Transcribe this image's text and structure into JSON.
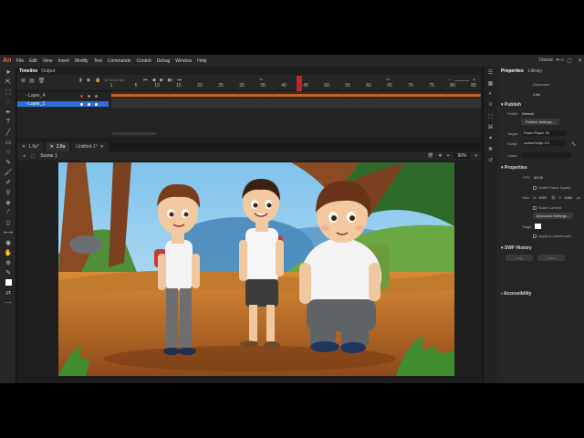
{
  "app": {
    "logo": "An",
    "menu": [
      "File",
      "Edit",
      "View",
      "Insert",
      "Modify",
      "Text",
      "Commands",
      "Control",
      "Debug",
      "Window",
      "Help"
    ],
    "workspace": "Classic"
  },
  "timeline": {
    "tabs": [
      "Timeline",
      "Output"
    ],
    "fps_readout": "10    30.00 fps",
    "ruler": [
      "1",
      "5",
      "10",
      "15",
      "20",
      "25",
      "30",
      "35",
      "40",
      "45",
      "50",
      "55",
      "60",
      "65",
      "70",
      "75",
      "80",
      "85"
    ],
    "seconds": [
      "1s",
      "2s"
    ],
    "layers": [
      {
        "name": "Layer_4",
        "selected": false
      },
      {
        "name": "Layer_1",
        "selected": true
      }
    ]
  },
  "documents": {
    "tabs": [
      "1.fla*",
      "2.fla",
      "Untitled-1*"
    ],
    "scene": "Scene 1",
    "zoom": "90%"
  },
  "properties": {
    "tabs": [
      "Properties",
      "Library"
    ],
    "doc_label": "Document",
    "file_name": "2.fla",
    "publish_heading": "Publish",
    "profile_label": "Profile:",
    "profile_value": "Default",
    "publish_settings_btn": "Publish Settings...",
    "target_label": "Target:",
    "target_value": "Flash Player 30",
    "script_label": "Script:",
    "script_value": "ActionScript 3.0",
    "class_label": "Class:",
    "properties_heading": "Properties",
    "fps_label": "FPS",
    "fps_value": "30.00",
    "scale_frame_spans": "Scale Frame Spans",
    "size_label": "Size:",
    "width_label": "W",
    "width_value": "1920",
    "height_label": "H",
    "height_value": "1080",
    "px_unit": "px",
    "scale_content": "Scale Content",
    "advanced_settings_btn": "Advanced Settings...",
    "stage_label": "Stage:",
    "apply_pasteboard": "Apply to pasteboard",
    "swf_history_heading": "SWF History",
    "log_btn": "Log",
    "clear_btn": "Clear",
    "accessibility_heading": "Accessibility"
  },
  "colors": {
    "accent": "#ff6a2b",
    "selection": "#2f6fd6",
    "playhead": "#c0272d",
    "waveform": "#d46a1e"
  }
}
